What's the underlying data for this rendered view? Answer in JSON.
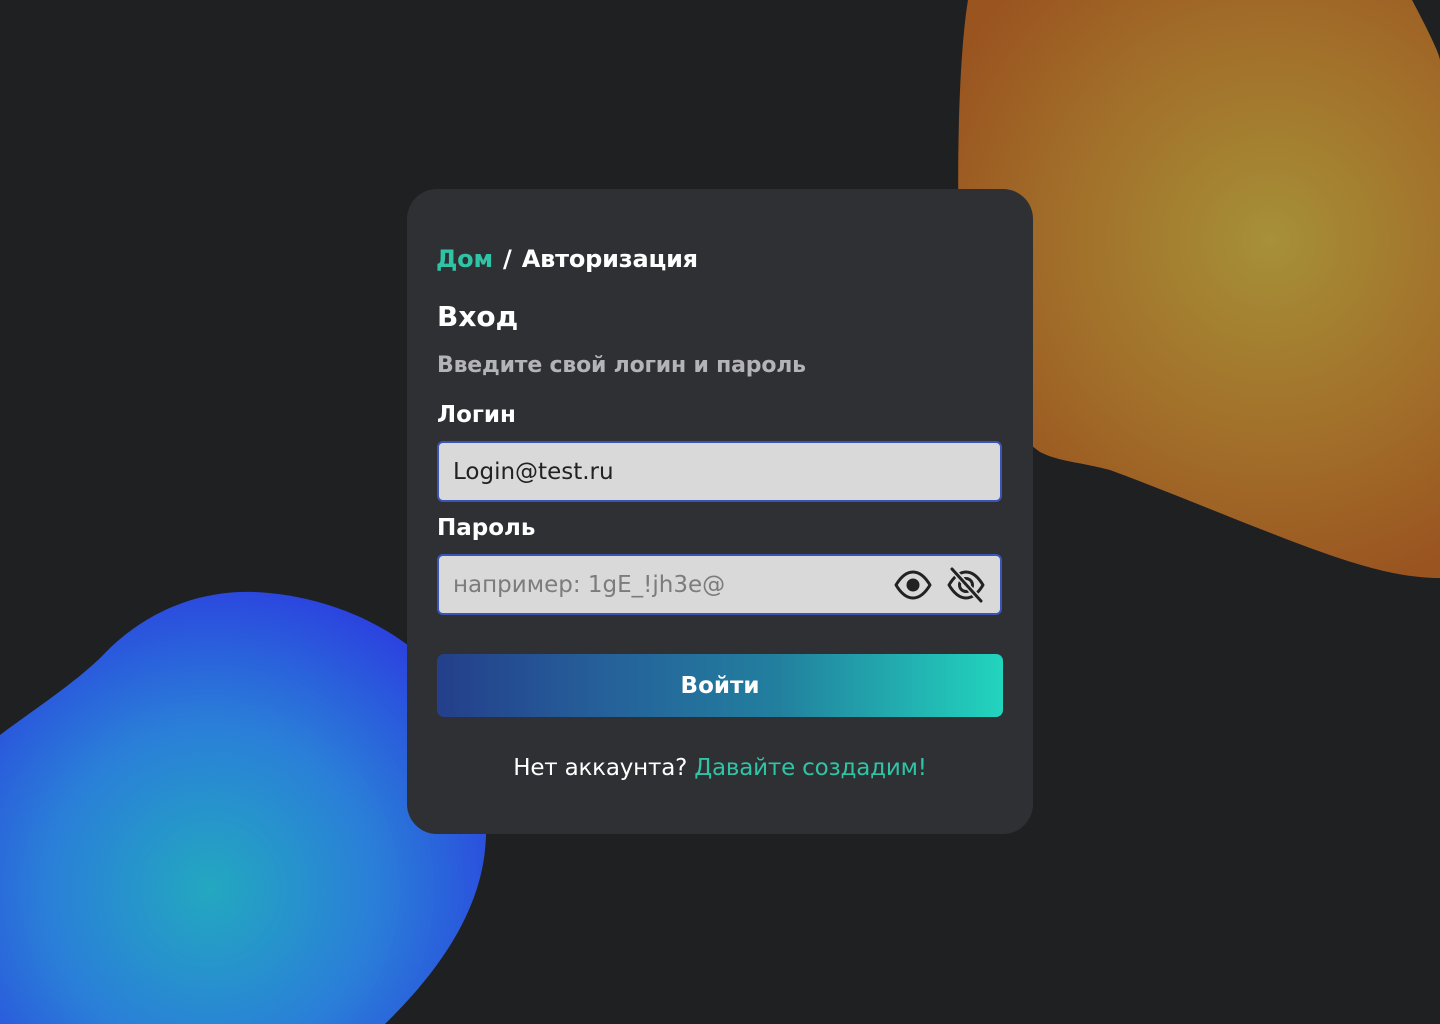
{
  "breadcrumb": {
    "home": "Дом",
    "separator": "/",
    "current": "Авторизация"
  },
  "page": {
    "title": "Вход",
    "subtitle": "Введите свой логин и пароль"
  },
  "form": {
    "login_label": "Логин",
    "login_value": "Login@test.ru",
    "password_label": "Пароль",
    "password_placeholder": "например: 1gE_!jh3e@",
    "password_value": "",
    "show_password_icon": "eye-icon",
    "hide_password_icon": "eye-off-icon",
    "submit_label": "Войти"
  },
  "signup": {
    "prompt": "Нет аккаунта?",
    "link_label": "Давайте создадим!"
  },
  "colors": {
    "background": "#1f2022",
    "card": "#2f3034",
    "accent": "#2ec4a5",
    "input_bg": "#d9d9d9",
    "input_border": "#3a55b5",
    "button_gradient": [
      "#243f8b",
      "#22d4be"
    ],
    "blob_orange": "#c77a24",
    "blob_blue": "#2a3fe0"
  }
}
